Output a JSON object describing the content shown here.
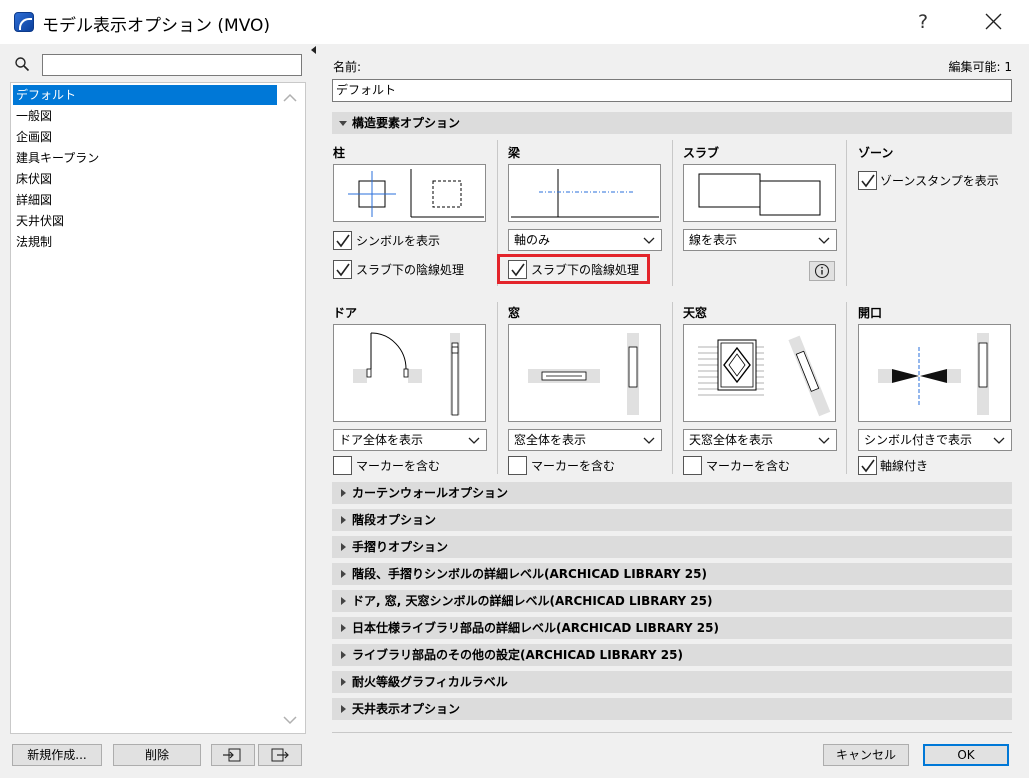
{
  "window": {
    "title": "モデル表示オプション (MVO)",
    "help_label": "?"
  },
  "search": {
    "value": ""
  },
  "list": {
    "items": [
      "デフォルト",
      "一般図",
      "企画図",
      "建具キープラン",
      "床伏図",
      "詳細図",
      "天井伏図",
      "法規制"
    ],
    "selected_index": 0
  },
  "left_buttons": {
    "new_label": "新規作成...",
    "delete_label": "削除"
  },
  "name": {
    "label": "名前:",
    "value": "デフォルト",
    "editable_label": "編集可能: 1"
  },
  "structural_section": {
    "title": "構造要素オプション",
    "column": {
      "title": "柱",
      "cb_symbol": {
        "label": "シンボルを表示",
        "checked": true
      },
      "cb_shading": {
        "label": "スラブ下の陰線処理",
        "checked": true
      }
    },
    "beam": {
      "title": "梁",
      "dropdown": "軸のみ",
      "cb_shading": {
        "label": "スラブ下の陰線処理",
        "checked": true
      }
    },
    "slab": {
      "title": "スラブ",
      "dropdown": "線を表示"
    },
    "zone": {
      "title": "ゾーン",
      "cb_stamp": {
        "label": "ゾーンスタンプを表示",
        "checked": true
      }
    },
    "door": {
      "title": "ドア",
      "dropdown": "ドア全体を表示",
      "cb_marker": {
        "label": "マーカーを含む",
        "checked": false
      }
    },
    "window": {
      "title": "窓",
      "dropdown": "窓全体を表示",
      "cb_marker": {
        "label": "マーカーを含む",
        "checked": false
      }
    },
    "skylight": {
      "title": "天窓",
      "dropdown": "天窓全体を表示",
      "cb_marker": {
        "label": "マーカーを含む",
        "checked": false
      }
    },
    "opening": {
      "title": "開口",
      "dropdown": "シンボル付きで表示",
      "cb_axis": {
        "label": "軸線付き",
        "checked": true
      }
    }
  },
  "collapsed_sections": [
    "カーテンウォールオプション",
    "階段オプション",
    "手摺りオプション",
    "階段、手摺りシンボルの詳細レベル(ARCHICAD LIBRARY 25)",
    "ドア, 窓, 天窓シンボルの詳細レベル(ARCHICAD LIBRARY 25)",
    "日本仕様ライブラリ部品の詳細レベル(ARCHICAD LIBRARY 25)",
    "ライブラリ部品のその他の設定(ARCHICAD LIBRARY 25)",
    "耐火等級グラフィカルラベル",
    "天井表示オプション"
  ],
  "footer": {
    "cancel_label": "キャンセル",
    "ok_label": "OK"
  },
  "colors": {
    "selection": "#0078d7",
    "highlight": "#e3242b",
    "section_header": "#dcdcdc",
    "axis_blue": "#2a6fdb"
  }
}
